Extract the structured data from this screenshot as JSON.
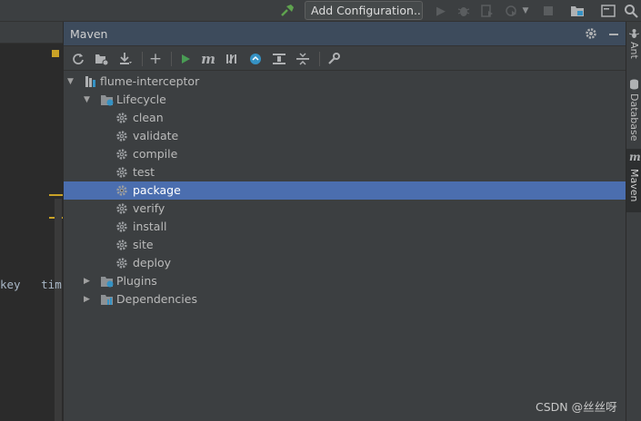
{
  "toolbar": {
    "run_config_label": "Add Configuration..."
  },
  "editor": {
    "visible_text": "key   tim"
  },
  "maven_panel": {
    "title": "Maven",
    "tree": {
      "project": "flume-interceptor",
      "lifecycle": {
        "label": "Lifecycle",
        "phases": [
          "clean",
          "validate",
          "compile",
          "test",
          "package",
          "verify",
          "install",
          "site",
          "deploy"
        ],
        "selected": "package"
      },
      "plugins": "Plugins",
      "dependencies": "Dependencies"
    }
  },
  "right_stripe": {
    "tabs": [
      {
        "label": "Ant",
        "icon": "ant-icon"
      },
      {
        "label": "Database",
        "icon": "database-icon"
      },
      {
        "label": "Maven",
        "icon": "maven-m-icon"
      }
    ],
    "active": "Maven"
  },
  "watermark": "CSDN @丝丝呀",
  "colors": {
    "panel_bg": "#3c3f41",
    "header_bg": "#3d4b5c",
    "selection": "#4b6eaf",
    "run_green": "#499c54",
    "hammer_green": "#5fa34f",
    "folder_blue": "#3592c4"
  }
}
